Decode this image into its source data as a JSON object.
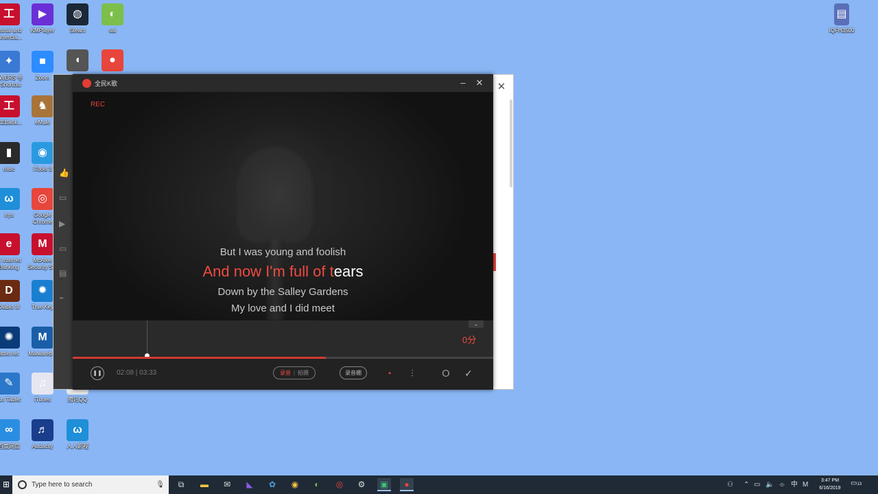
{
  "desktop": {
    "icons_col1": [
      {
        "label": "ustrial and\nmmercia...",
        "icon": "bank-icon",
        "color": "#c8102e",
        "glyph": "工"
      },
      {
        "label": "OWERS 冬\n- Shortcut",
        "icon": "star-icon",
        "color": "#3a79d4",
        "glyph": "✦"
      },
      {
        "label": "ICEBank...",
        "icon": "bank-icon",
        "color": "#c8102e",
        "glyph": "工"
      },
      {
        "label": "misc",
        "icon": "folder-icon",
        "color": "#2a2a2a",
        "glyph": "▮"
      },
      {
        "label": "rrys",
        "icon": "rrys-icon",
        "color": "#1e8fd8",
        "glyph": "ω"
      },
      {
        "label": "C Internet\nBanking",
        "icon": "ie-icon",
        "color": "#c8102e",
        "glyph": "e"
      },
      {
        "label": "Diablo III",
        "icon": "diablo-icon",
        "color": "#6b2a12",
        "glyph": "D"
      },
      {
        "label": "attle.net",
        "icon": "battlenet-icon",
        "color": "#0a3b78",
        "glyph": "✺"
      },
      {
        "label": "ion Tablet",
        "icon": "tablet-icon",
        "color": "#2b77c9",
        "glyph": "✎"
      },
      {
        "label": "百度网盘",
        "icon": "baidu-icon",
        "color": "#2a8ee0",
        "glyph": "∞"
      }
    ],
    "icons_col2": [
      {
        "label": "KMPlayer",
        "icon": "kmplayer-icon",
        "color": "#6a2fd6",
        "glyph": "▶"
      },
      {
        "label": "Zoom",
        "icon": "zoom-icon",
        "color": "#2d8cff",
        "glyph": "■"
      },
      {
        "label": "eMule",
        "icon": "emule-icon",
        "color": "#a8743a",
        "glyph": "♞"
      },
      {
        "label": "iTools 3",
        "icon": "itools-icon",
        "color": "#2a9ae0",
        "glyph": "◉"
      },
      {
        "label": "Google\nChrome",
        "icon": "chrome-icon",
        "color": "#e8453c",
        "glyph": "◎"
      },
      {
        "label": "McAfee\nSecurity S...",
        "icon": "mcafee-icon",
        "color": "#c8102e",
        "glyph": "M"
      },
      {
        "label": "True Key",
        "icon": "truekey-icon",
        "color": "#1a7fd0",
        "glyph": "✹"
      },
      {
        "label": "Malwareb...",
        "icon": "malwarebytes-icon",
        "color": "#1a5ea8",
        "glyph": "M"
      },
      {
        "label": "iTunes",
        "icon": "itunes-icon",
        "color": "#e6e6f0",
        "glyph": "♫"
      },
      {
        "label": "Audacity",
        "icon": "audacity-icon",
        "color": "#1a3e8c",
        "glyph": "♬"
      }
    ],
    "icons_col3": [
      {
        "label": "Steam",
        "icon": "steam-icon",
        "color": "#1b2838",
        "glyph": "◍"
      },
      {
        "label": "",
        "icon": "speaker-icon",
        "color": "#555555",
        "glyph": "◖"
      },
      {
        "label": "腾讯QQ",
        "icon": "qq-icon",
        "color": "#e6e6e6",
        "glyph": ""
      },
      {
        "label": "人人影视",
        "icon": "rrys-icon",
        "color": "#1e8fd8",
        "glyph": "ω"
      }
    ],
    "icons_col4": [
      {
        "label": "sai",
        "icon": "sai-icon",
        "color": "#7cbf4a",
        "glyph": "◐"
      },
      {
        "label": "",
        "icon": "karaoke-icon",
        "color": "#e8453c",
        "glyph": "●"
      }
    ],
    "top_right_icon": {
      "label": "IQFH3500",
      "icon": "document-icon",
      "color": "#5a6fb8",
      "glyph": "▤"
    }
  },
  "karaoke": {
    "title": "全民K歌",
    "rec_label": "REC",
    "lyrics": {
      "previous": "But I was young and foolish",
      "current_sung": "And now I'm full of t",
      "current_unsung": "ears",
      "next1": "Down by the Salley Gardens",
      "next2": "My love and I did meet"
    },
    "score": "0分",
    "time": "02:08 | 03:33",
    "progress": 0.602,
    "mode_active": "录音",
    "mode_sep": "|",
    "mode_other": "拍摄",
    "studio_label": "录音棚",
    "accent": "#ef4b41"
  },
  "taskbar": {
    "search_placeholder": "Type here to search",
    "clock_time": "3:47 PM",
    "clock_date": "6/16/2019",
    "notification_count": "13"
  }
}
